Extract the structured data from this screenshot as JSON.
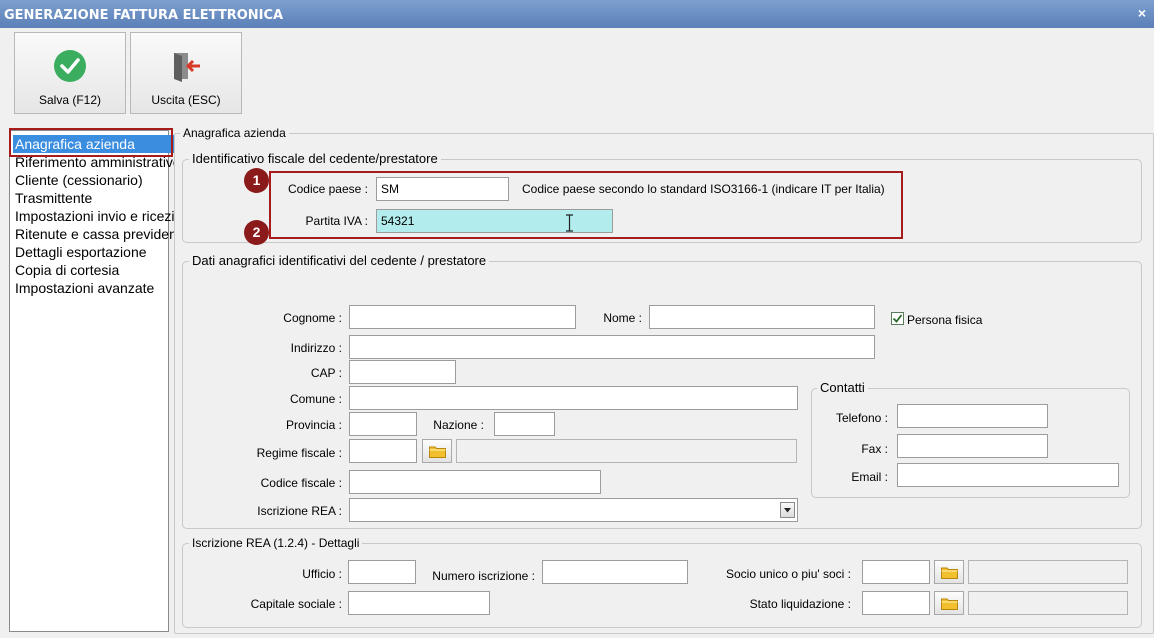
{
  "window": {
    "title": "GENERAZIONE FATTURA ELETTRONICA",
    "close_glyph": "×"
  },
  "toolbar": {
    "save_label": "Salva (F12)",
    "exit_label": "Uscita (ESC)",
    "save_icon": "check-circle-icon",
    "exit_icon": "exit-door-icon"
  },
  "sidebar": {
    "items": [
      {
        "label": "Anagrafica azienda"
      },
      {
        "label": "Riferimento amministrativo"
      },
      {
        "label": "Cliente (cessionario)"
      },
      {
        "label": "Trasmittente"
      },
      {
        "label": "Impostazioni invio e ricezione"
      },
      {
        "label": "Ritenute e cassa previdenziale"
      },
      {
        "label": "Dettagli esportazione"
      },
      {
        "label": "Copia di cortesia"
      },
      {
        "label": "Impostazioni avanzate"
      }
    ]
  },
  "main": {
    "section_title": "Anagrafica azienda",
    "fiscal": {
      "title": "Identificativo fiscale del cedente/prestatore",
      "codice_paese_label": "Codice paese :",
      "codice_paese_value": "SM",
      "codice_paese_hint": "Codice paese secondo lo standard ISO3166-1 (indicare IT per Italia)",
      "partita_iva_label": "Partita IVA :",
      "partita_iva_value": "54321",
      "marker_1": "1",
      "marker_2": "2"
    },
    "anagrafica": {
      "title": "Dati anagrafici identificativi del cedente / prestatore",
      "cognome_label": "Cognome :",
      "nome_label": "Nome :",
      "persona_fisica_label": "Persona fisica",
      "persona_fisica_checked": true,
      "indirizzo_label": "Indirizzo :",
      "cap_label": "CAP :",
      "comune_label": "Comune :",
      "provincia_label": "Provincia :",
      "nazione_label": "Nazione :",
      "regime_label": "Regime fiscale :",
      "codice_fiscale_label": "Codice fiscale :",
      "rea_label": "Iscrizione REA :",
      "contatti": {
        "title": "Contatti",
        "telefono_label": "Telefono :",
        "fax_label": "Fax :",
        "email_label": "Email :"
      }
    },
    "rea": {
      "title": "Iscrizione REA (1.2.4) - Dettagli",
      "ufficio_label": "Ufficio :",
      "numero_label": "Numero iscrizione :",
      "socio_label": "Socio unico o piu' soci :",
      "capitale_label": "Capitale sociale :",
      "stato_label": "Stato liquidazione :"
    }
  },
  "colors": {
    "accent": "#3b8de0",
    "highlight_red": "#a61c1c",
    "partita_iva_bg": "#b2ecec",
    "check_green": "#3aae5e"
  }
}
